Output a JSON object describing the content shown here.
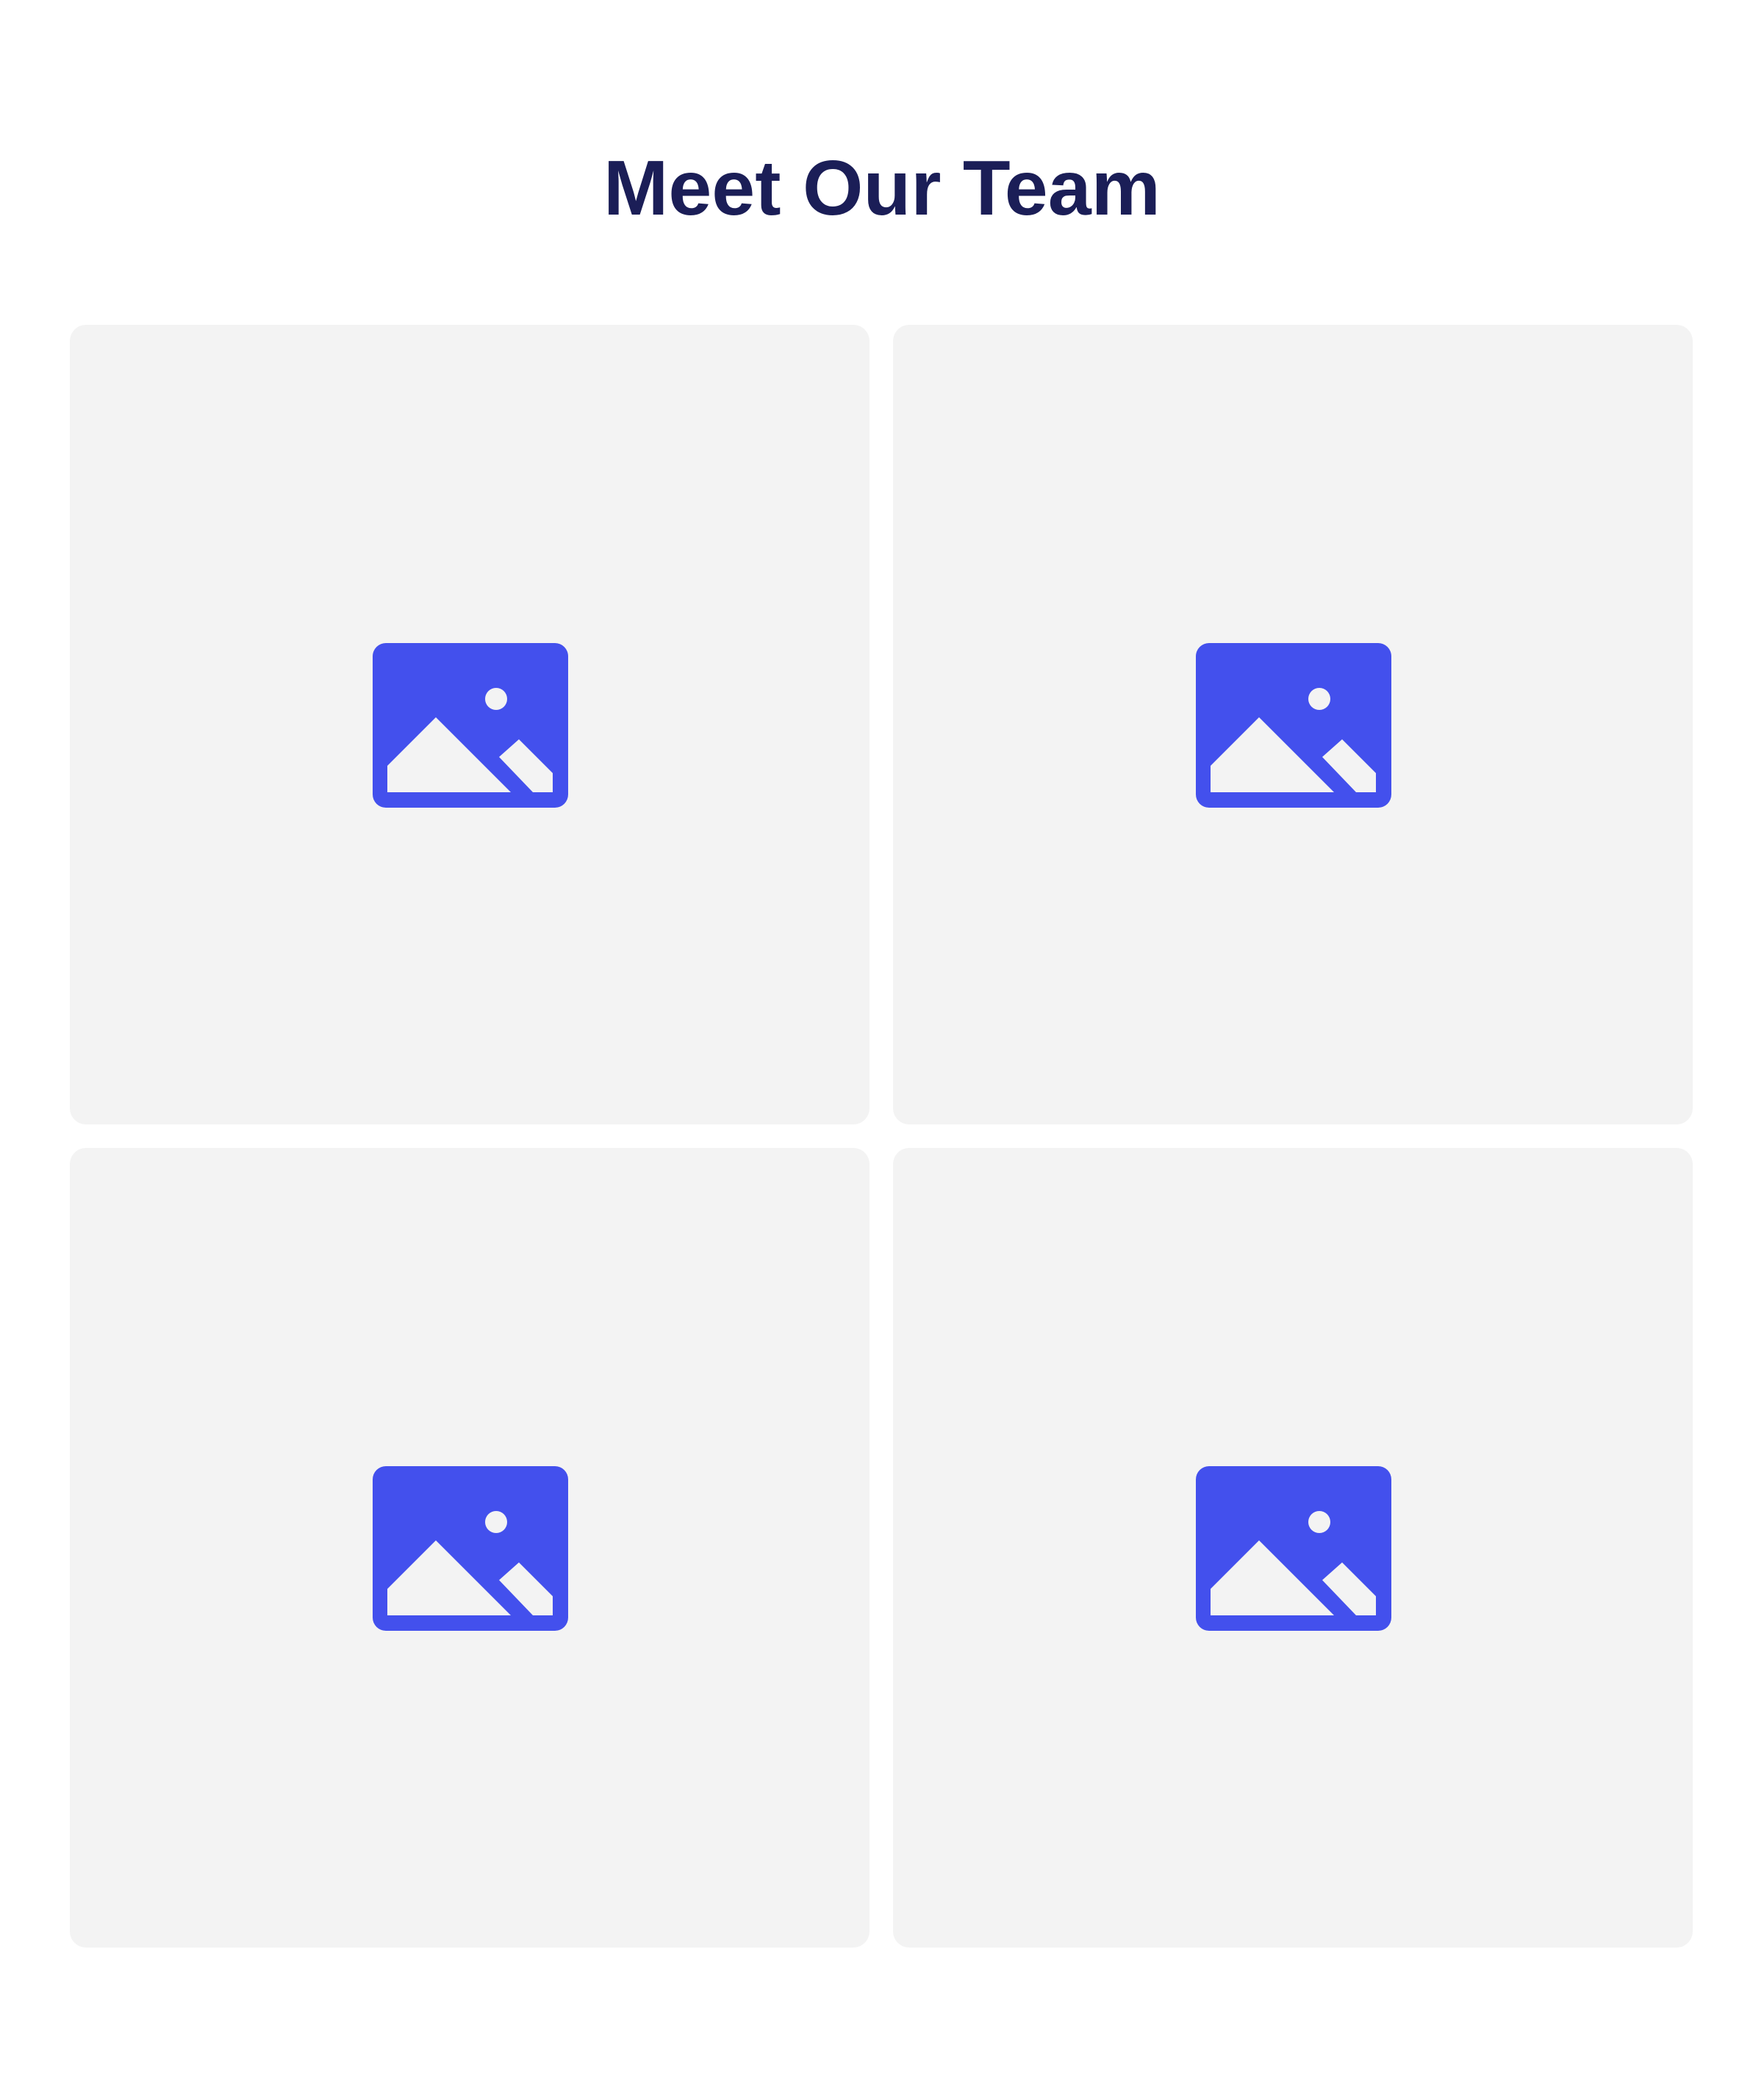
{
  "section": {
    "title": "Meet Our Team"
  },
  "colors": {
    "title": "#1b1e57",
    "card_background": "#f3f3f3",
    "icon_accent": "#4350ed",
    "icon_cutout": "#f3f3f3",
    "page_background": "#ffffff"
  },
  "members": [
    {
      "image_icon": "image-placeholder-icon"
    },
    {
      "image_icon": "image-placeholder-icon"
    },
    {
      "image_icon": "image-placeholder-icon"
    },
    {
      "image_icon": "image-placeholder-icon"
    }
  ]
}
